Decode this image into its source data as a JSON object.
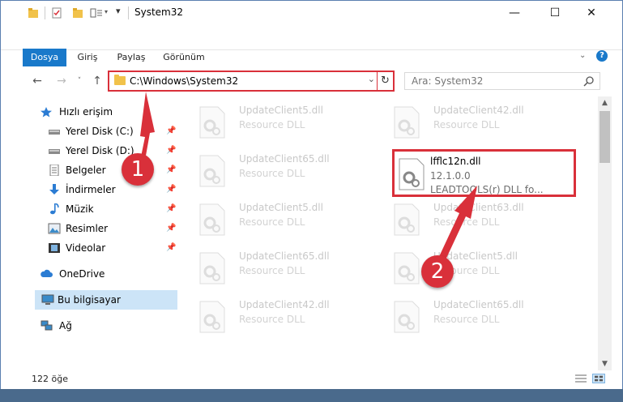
{
  "window": {
    "title": "System32"
  },
  "ribbon": {
    "tabs": [
      "Dosya",
      "Giriş",
      "Paylaş",
      "Görünüm"
    ]
  },
  "address": {
    "path": "C:\\Windows\\System32"
  },
  "search": {
    "placeholder": "Ara: System32"
  },
  "sidebar": {
    "items": [
      {
        "label": "Hızlı erişim",
        "icon": "star-icon"
      },
      {
        "label": "Yerel Disk (C:)",
        "icon": "drive-icon",
        "pinned": true
      },
      {
        "label": "Yerel Disk (D:)",
        "icon": "drive-icon",
        "pinned": true
      },
      {
        "label": "Belgeler",
        "icon": "documents-icon",
        "pinned": true
      },
      {
        "label": "İndirmeler",
        "icon": "download-icon",
        "pinned": true
      },
      {
        "label": "Müzik",
        "icon": "music-icon",
        "pinned": true
      },
      {
        "label": "Resimler",
        "icon": "pictures-icon",
        "pinned": true
      },
      {
        "label": "Videolar",
        "icon": "video-icon",
        "pinned": true
      },
      {
        "label": "OneDrive",
        "icon": "cloud-icon"
      },
      {
        "label": "Bu bilgisayar",
        "icon": "computer-icon",
        "selected": true
      },
      {
        "label": "Ağ",
        "icon": "network-icon"
      }
    ]
  },
  "files": [
    {
      "name": "UpdateClient5.dll",
      "desc": "Resource DLL"
    },
    {
      "name": "UpdateClient42.dll",
      "desc": "Resource DLL"
    },
    {
      "name": "UpdateClient65.dll",
      "desc": "Resource DLL"
    },
    {
      "name": "lfflc12n.dll",
      "version": "12.1.0.0",
      "desc": "LEADTOOLS(r) DLL fo...",
      "highlighted": true
    },
    {
      "name": "UpdateClient5.dll",
      "desc": "Resource DLL"
    },
    {
      "name": "UpdateClient63.dll",
      "desc": "Resource DLL"
    },
    {
      "name": "UpdateClient65.dll",
      "desc": "Resource DLL"
    },
    {
      "name": "UpdateClient5.dll",
      "desc": "Resource DLL"
    },
    {
      "name": "UpdateClient42.dll",
      "desc": "Resource DLL"
    },
    {
      "name": "UpdateClient65.dll",
      "desc": "Resource DLL"
    }
  ],
  "status": {
    "count": "122 öğe"
  },
  "annotations": {
    "step1": "1",
    "step2": "2",
    "color": "#d9303a"
  }
}
